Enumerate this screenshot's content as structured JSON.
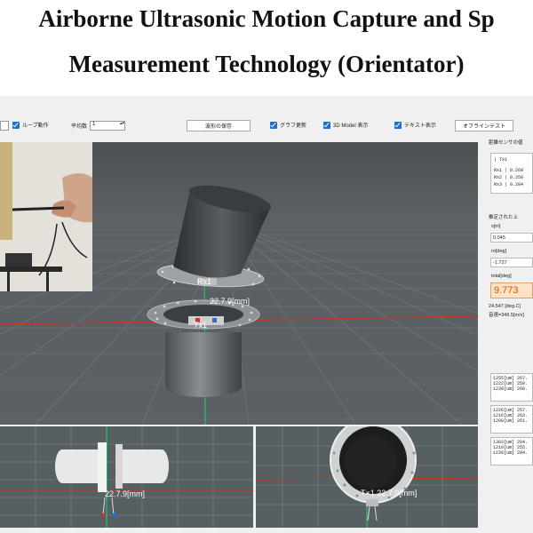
{
  "page": {
    "title_line1": "Airborne Ultrasonic Motion Capture and Sp",
    "title_line2": "Measurement Technology (Orientator)"
  },
  "toolbar": {
    "loop_label": "ループ動作",
    "avg_label": "平均数",
    "avg_value": "1",
    "save_waveform": "波形の保存",
    "graph_update": "グラフ更新",
    "model_3d": "3D Model 表示",
    "text_display": "テキスト表示",
    "offline_test": "オフラインテスト"
  },
  "viewport": {
    "label_rx1": "Rx1",
    "label_distance_main": "22.7.9[mm]",
    "label_tx1": "Tx1",
    "label_distance_side": "22.7.9[mm]",
    "label_distance_top": "T×1 22.7.9[mm]"
  },
  "panel": {
    "sensor_title": "距離センサの値",
    "table_header": "|  Tx1",
    "table_rows": [
      "Rx1 | 0.268",
      "Rx2 | 0.250",
      "Rx3 | 0.284"
    ],
    "estimated_title": "推定された上",
    "x_label": "x[m]",
    "x_value": "0.045",
    "ro_label": "ro[deg]",
    "ro_value": "-1.727",
    "total_label": "total[deg]",
    "total_value": "9.773",
    "note_line1": "24.547 [deg.C]",
    "note_line2": "音速=346.5[m/s]",
    "log1": "1255[um] 267.\n1222[um] 259.\n1230[um] 268.",
    "log2": "1226[um] 257.\n1216[um] 263.\n1208[um] 261.",
    "log3": "1303[um] 284.\n1210[um] 255.\n1150[um] 284."
  },
  "colors": {
    "accent_checkbox": "#1a6fd6",
    "total_highlight_bg": "#fde2c8",
    "total_highlight_text": "#d35a00",
    "viewport_bg": "#4e5457"
  }
}
